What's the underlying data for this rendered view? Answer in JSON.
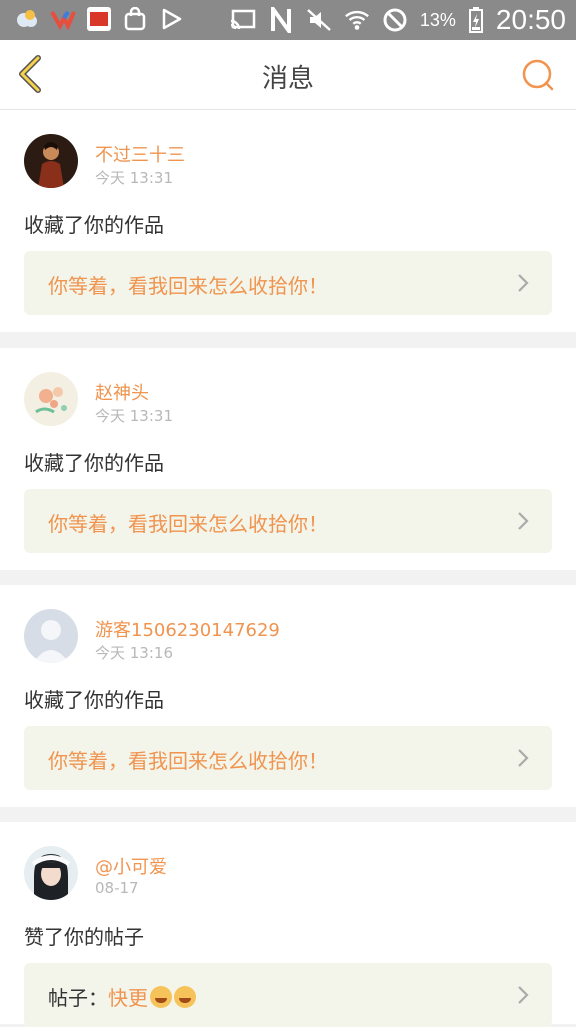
{
  "status_bar": {
    "battery": "13%",
    "time": "20:50",
    "left_icons": [
      "weather-icon",
      "v-app-icon",
      "news-app-icon",
      "shopping-bag-icon",
      "play-store-icon"
    ],
    "right_icons": [
      "cast-icon",
      "nfc-icon",
      "mute-icon",
      "wifi-icon",
      "do-not-disturb-icon",
      "battery-icon"
    ]
  },
  "header": {
    "title": "消息",
    "accent_color": "#f0944f",
    "back_icon_color": "#f7d24a"
  },
  "messages": [
    {
      "username": "不过三十三",
      "time": "今天 13:31",
      "action": "收藏了你的作品",
      "quote": "你等着，看我回来怎么收拾你！",
      "avatar": "dark-figure-avatar"
    },
    {
      "username": "赵神头",
      "time": "今天 13:31",
      "action": "收藏了你的作品",
      "quote": "你等着，看我回来怎么收拾你！",
      "avatar": "flower-avatar"
    },
    {
      "username": "游客1506230147629",
      "time": "今天 13:16",
      "action": "收藏了你的作品",
      "quote": "你等着，看我回来怎么收拾你！",
      "avatar": "default-user-avatar"
    },
    {
      "username": "@小可爱",
      "time": "08-17",
      "action": "赞了你的帖子",
      "quote_label": "帖子：",
      "quote": "快更",
      "avatar": "girl-avatar",
      "emoji_icons": [
        "laughing-emoji-icon",
        "laughing-emoji-icon"
      ]
    }
  ]
}
